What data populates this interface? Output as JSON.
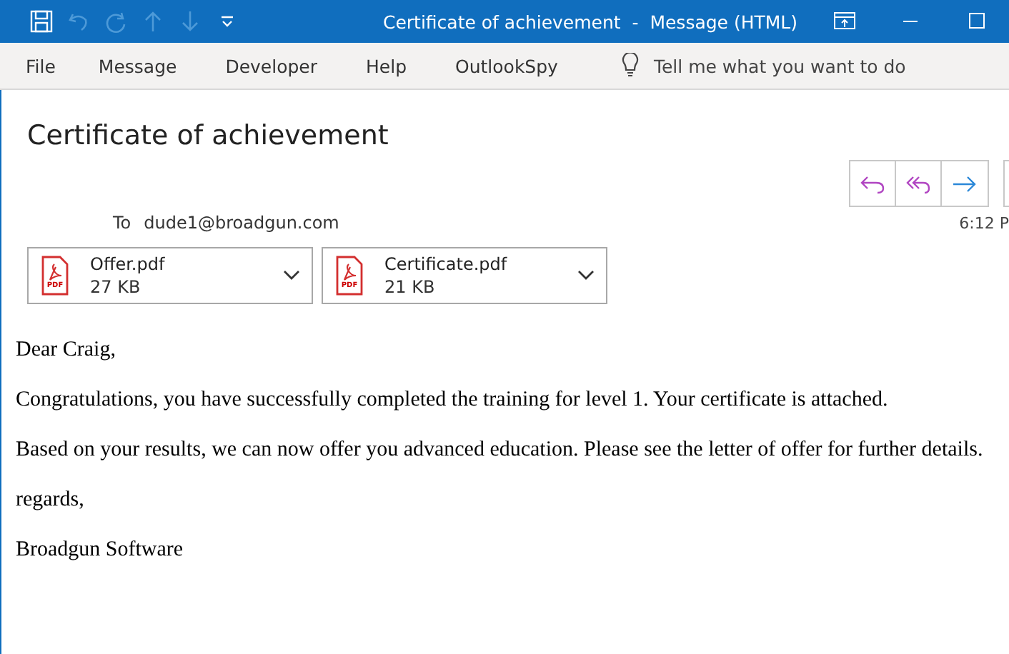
{
  "title_bar": {
    "quick_access": [
      {
        "kind": "save",
        "disabled": false
      },
      {
        "kind": "undo",
        "disabled": true
      },
      {
        "kind": "redo",
        "disabled": true
      },
      {
        "kind": "up",
        "disabled": true
      },
      {
        "kind": "down",
        "disabled": true
      },
      {
        "kind": "customize",
        "disabled": false
      }
    ],
    "title": "Certificate of achievement  -  Message (HTML)"
  },
  "menu": {
    "items": [
      "File",
      "Message",
      "Developer",
      "Help",
      "OutlookSpy"
    ],
    "search": {
      "placeholder": "Tell me what you want to do"
    }
  },
  "message": {
    "subject": "Certificate of achievement",
    "to_label": "To",
    "to": "dude1@broadgun.com",
    "time": "6:12 P",
    "attachments": [
      {
        "name": "Offer.pdf",
        "size": "27 KB",
        "icon_label": "PDF"
      },
      {
        "name": "Certificate.pdf",
        "size": "21 KB",
        "icon_label": "PDF"
      }
    ],
    "body": [
      "Dear Craig,",
      "Congratulations, you have successfully completed the training for level 1. Your certificate is attached.",
      "Based on your results, we can now offer you advanced education. Please see the letter of offer for further details.",
      "regards,",
      "Broadgun Software"
    ]
  }
}
